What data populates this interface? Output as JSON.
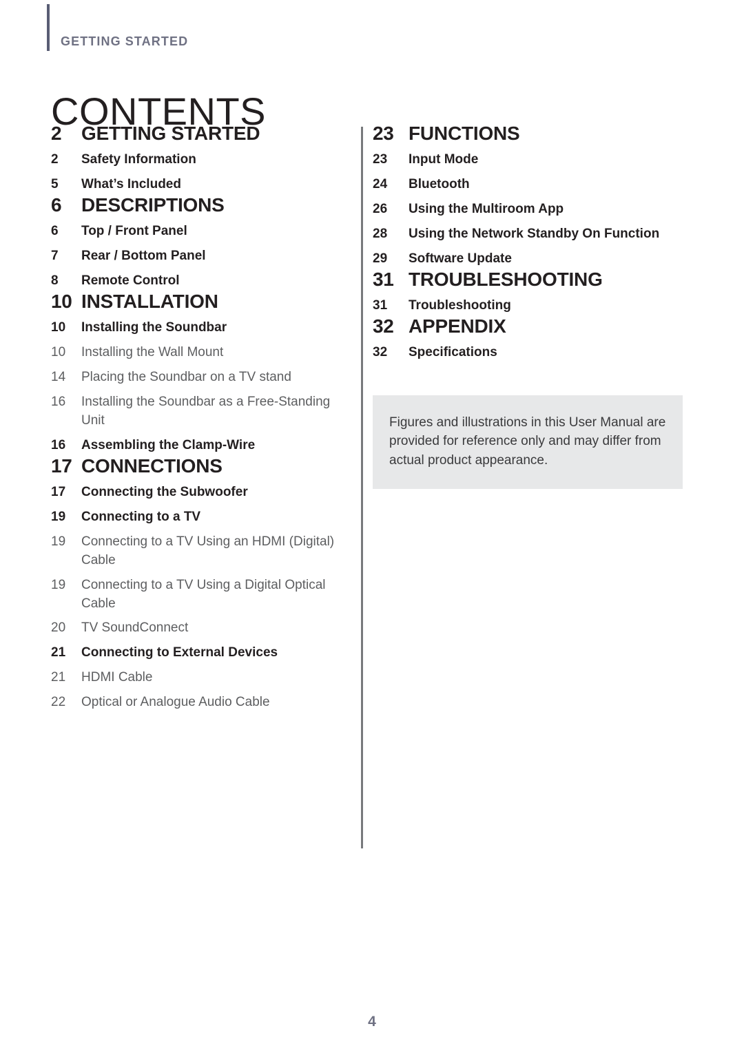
{
  "header": {
    "running_head": "GETTING STARTED",
    "page_title": "CONTENTS",
    "accent_color": "#595d74"
  },
  "left_column": {
    "sections": [
      {
        "num": "2",
        "title": "GETTING STARTED",
        "entries": [
          {
            "num": "2",
            "title": "Safety Information",
            "level": 1
          },
          {
            "num": "5",
            "title": "What’s Included",
            "level": 1
          }
        ]
      },
      {
        "num": "6",
        "title": "DESCRIPTIONS",
        "entries": [
          {
            "num": "6",
            "title": "Top / Front Panel",
            "level": 1
          },
          {
            "num": "7",
            "title": "Rear / Bottom Panel",
            "level": 1
          },
          {
            "num": "8",
            "title": "Remote Control",
            "level": 1
          }
        ]
      },
      {
        "num": "10",
        "title": "INSTALLATION",
        "entries": [
          {
            "num": "10",
            "title": "Installing the Soundbar",
            "level": 1
          },
          {
            "num": "10",
            "title": "Installing the Wall Mount",
            "level": 2
          },
          {
            "num": "14",
            "title": "Placing the Soundbar on a TV stand",
            "level": 2
          },
          {
            "num": "16",
            "title": "Installing the Soundbar as a Free-Standing Unit",
            "level": 2
          },
          {
            "num": "16",
            "title": "Assembling the Clamp-Wire",
            "level": 1
          }
        ]
      },
      {
        "num": "17",
        "title": "CONNECTIONS",
        "entries": [
          {
            "num": "17",
            "title": "Connecting the Subwoofer",
            "level": 1
          },
          {
            "num": "19",
            "title": "Connecting to a TV",
            "level": 1
          },
          {
            "num": "19",
            "title": "Connecting to a TV Using an HDMI (Digital) Cable",
            "level": 2
          },
          {
            "num": "19",
            "title": "Connecting to a TV Using a Digital Optical Cable",
            "level": 2
          },
          {
            "num": "20",
            "title": "TV SoundConnect",
            "level": 2
          },
          {
            "num": "21",
            "title": "Connecting to External Devices",
            "level": 1
          },
          {
            "num": "21",
            "title": "HDMI Cable",
            "level": 2
          },
          {
            "num": "22",
            "title": "Optical or Analogue Audio Cable",
            "level": 2
          }
        ]
      }
    ]
  },
  "right_column": {
    "sections": [
      {
        "num": "23",
        "title": "FUNCTIONS",
        "entries": [
          {
            "num": "23",
            "title": "Input Mode",
            "level": 1
          },
          {
            "num": "24",
            "title": "Bluetooth",
            "level": 1
          },
          {
            "num": "26",
            "title": "Using the Multiroom App",
            "level": 1
          },
          {
            "num": "28",
            "title": "Using the Network Standby On Function",
            "level": 1
          },
          {
            "num": "29",
            "title": "Software Update",
            "level": 1
          }
        ]
      },
      {
        "num": "31",
        "title": "TROUBLESHOOTING",
        "entries": [
          {
            "num": "31",
            "title": "Troubleshooting",
            "level": 1
          }
        ]
      },
      {
        "num": "32",
        "title": "APPENDIX",
        "entries": [
          {
            "num": "32",
            "title": "Specifications",
            "level": 1
          }
        ]
      }
    ],
    "note": "Figures and illustrations in this User Manual are provided for reference only and may differ from actual product appearance."
  },
  "footer": {
    "page_number": "4"
  }
}
